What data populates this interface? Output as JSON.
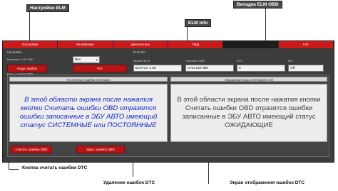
{
  "callouts": {
    "elm_settings": "Настройки ELM",
    "obd_tab": "Вкладка ELM OBD",
    "elm_info": "ELM info",
    "read_dtc": "Кнопка считать ошибки DTC",
    "delete_dtc": "Удаление ошибок DTC",
    "dtc_screen": "Экран отображения ошибок  DTC"
  },
  "tabs": [
    {
      "label": "Настройки",
      "active": false
    },
    {
      "label": "Калибровка",
      "active": false
    },
    {
      "label": "Диагностика",
      "active": false
    },
    {
      "label": "ОБД",
      "active": false
    },
    {
      "label": "",
      "active": true
    },
    {
      "label": "Info",
      "active": false
    }
  ],
  "settings": {
    "section_label": "Настройки",
    "enable_label": "Включить ELM OBD",
    "enable_value": "Вкл",
    "obd_codes_button": "Коды ошибок",
    "pid_button": "PID"
  },
  "elm_info": {
    "section_label": "ELM Info",
    "version_label": "Версия ELM",
    "version_value": "ELM ver 1.55",
    "protocol_label": "Протокол OBD",
    "protocol_value": "CAN 250 kBit",
    "dtc_label": "DTC",
    "dtc_value": "0",
    "mil_label": "MIL",
    "mil_value": "Off"
  },
  "dtc": {
    "section_label": "Коды ошибок OBD",
    "left_header": "Постоянные ошибки неполадок",
    "right_header": "Ожидающие коды неисправностей",
    "left_text": "В этой области экрана после нажатия кнопки Считать ошибки OBD отразятся ошибки записанные в ЭБУ  АВТО имеющий статус СИСТЕМНЫЕ или ПОСТОЯННЫЕ",
    "right_text": "В этой области экрана после нажатия кнопки Считать ошибки OBD отразятся ошибки записанные в ЭБУ АВТО имеющий статус ОЖИДАЮЩИЕ",
    "read_button": "Считать ошибки OBD",
    "delete_button": "Удал. ошибок OBD"
  },
  "colors": {
    "tab_red": "#cc1a1a",
    "window_bg": "#3c3c3c",
    "left_text_blue": "#1228c8"
  }
}
